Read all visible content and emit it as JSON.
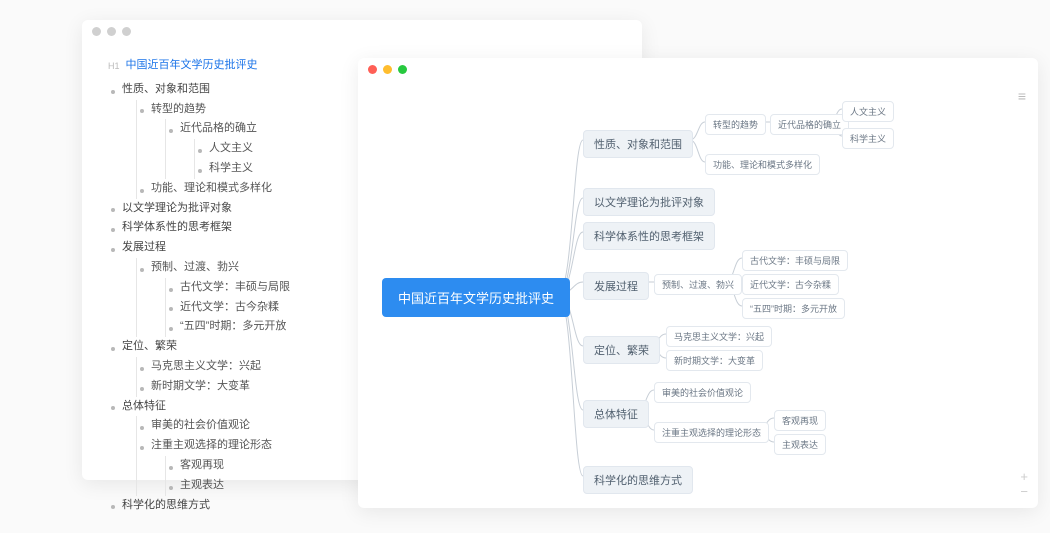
{
  "outline": {
    "root": "中国近百年文学历史批评史",
    "items": [
      {
        "label": "性质、对象和范围",
        "children": [
          {
            "label": "转型的趋势",
            "children": [
              {
                "label": "近代品格的确立",
                "children": [
                  {
                    "label": "人文主义"
                  },
                  {
                    "label": "科学主义"
                  }
                ]
              }
            ]
          },
          {
            "label": "功能、理论和模式多样化"
          }
        ]
      },
      {
        "label": "以文学理论为批评对象"
      },
      {
        "label": "科学体系性的思考框架"
      },
      {
        "label": "发展过程",
        "children": [
          {
            "label": "预制、过渡、勃兴",
            "children": [
              {
                "label": "古代文学：丰硕与局限"
              },
              {
                "label": "近代文学：古今杂糅"
              },
              {
                "label": "“五四”时期：多元开放"
              }
            ]
          }
        ]
      },
      {
        "label": "定位、繁荣",
        "children": [
          {
            "label": "马克思主义文学：兴起"
          },
          {
            "label": "新时期文学：大变革"
          }
        ]
      },
      {
        "label": "总体特征",
        "children": [
          {
            "label": "审美的社会价值观论"
          },
          {
            "label": "注重主观选择的理论形态",
            "children": [
              {
                "label": "客观再现"
              },
              {
                "label": "主观表达"
              }
            ]
          }
        ]
      },
      {
        "label": "科学化的思维方式"
      }
    ]
  },
  "mindmap": {
    "root": "中国近百年文学历史批评史",
    "l2": [
      {
        "id": "n1",
        "label": "性质、对象和范围"
      },
      {
        "id": "n2",
        "label": "以文学理论为批评对象"
      },
      {
        "id": "n3",
        "label": "科学体系性的思考框架"
      },
      {
        "id": "n4",
        "label": "发展过程"
      },
      {
        "id": "n5",
        "label": "定位、繁荣"
      },
      {
        "id": "n6",
        "label": "总体特征"
      },
      {
        "id": "n7",
        "label": "科学化的思维方式"
      }
    ],
    "l3": {
      "n1a": "转型的趋势",
      "n1b": "功能、理论和模式多样化",
      "n1a1": "近代品格的确立",
      "n1a1a": "人文主义",
      "n1a1b": "科学主义",
      "n4a": "预制、过渡、勃兴",
      "n4a1": "古代文学：丰硕与局限",
      "n4a2": "近代文学：古今杂糅",
      "n4a3": "“五四”时期：多元开放",
      "n5a": "马克思主义文学：兴起",
      "n5b": "新时期文学：大变革",
      "n6a": "审美的社会价值观论",
      "n6b": "注重主观选择的理论形态",
      "n6b1": "客观再现",
      "n6b2": "主观表达"
    }
  },
  "chart_data": {
    "type": "tree",
    "title": "中国近百年文学历史批评史",
    "root": {
      "name": "中国近百年文学历史批评史",
      "children": [
        {
          "name": "性质、对象和范围",
          "children": [
            {
              "name": "转型的趋势",
              "children": [
                {
                  "name": "近代品格的确立",
                  "children": [
                    {
                      "name": "人文主义"
                    },
                    {
                      "name": "科学主义"
                    }
                  ]
                }
              ]
            },
            {
              "name": "功能、理论和模式多样化"
            }
          ]
        },
        {
          "name": "以文学理论为批评对象"
        },
        {
          "name": "科学体系性的思考框架"
        },
        {
          "name": "发展过程",
          "children": [
            {
              "name": "预制、过渡、勃兴",
              "children": [
                {
                  "name": "古代文学：丰硕与局限"
                },
                {
                  "name": "近代文学：古今杂糅"
                },
                {
                  "name": "“五四”时期：多元开放"
                }
              ]
            }
          ]
        },
        {
          "name": "定位、繁荣",
          "children": [
            {
              "name": "马克思主义文学：兴起"
            },
            {
              "name": "新时期文学：大变革"
            }
          ]
        },
        {
          "name": "总体特征",
          "children": [
            {
              "name": "审美的社会价值观论"
            },
            {
              "name": "注重主观选择的理论形态",
              "children": [
                {
                  "name": "客观再现"
                },
                {
                  "name": "主观表达"
                }
              ]
            }
          ]
        },
        {
          "name": "科学化的思维方式"
        }
      ]
    }
  }
}
